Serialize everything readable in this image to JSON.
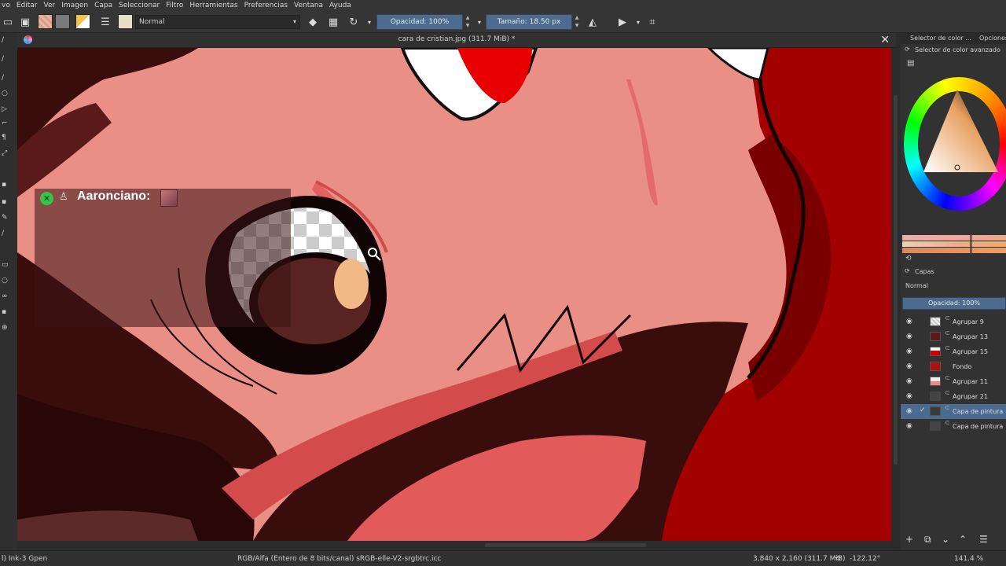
{
  "menu": [
    "vo",
    "Editar",
    "Ver",
    "Imagen",
    "Capa",
    "Seleccionar",
    "Filtro",
    "Herramientas",
    "Preferencias",
    "Ventana",
    "Ayuda"
  ],
  "toolbar": {
    "blend_mode": "Normal",
    "opacity_label": "Opacidad: 100%",
    "size_label": "Tamaño: 18.50 px"
  },
  "document": {
    "tab_title": "cara de cristian.jpg (311.7 MiB) *"
  },
  "overlay": {
    "username": "Aaronciano:"
  },
  "status": {
    "brush": "l) Ink-3 Gpen",
    "color_space": "RGB/Alfa (Entero de 8 bits/canal)  sRGB-elle-V2-srgbtrc.icc",
    "image_size": "3,840 x 2,160 (311.7 MiB)",
    "rotation": "-122.12°",
    "zoom": "141.4 %"
  },
  "docker": {
    "tab_color": "Selector de color ...",
    "tab_options": "Opciones",
    "advanced_color_title": "Selector de color avanzado",
    "layers_title": "Capas",
    "layers_blend": "Normal",
    "layers_opacity": "Opacidad: 100%",
    "layers": [
      {
        "name": "Agrupar 9",
        "checked": false,
        "selected": false
      },
      {
        "name": "Agrupar 13",
        "checked": false,
        "selected": false
      },
      {
        "name": "Agrupar 15",
        "checked": false,
        "selected": false
      },
      {
        "name": "Fondo",
        "checked": false,
        "selected": false
      },
      {
        "name": "Agrupar 11",
        "checked": false,
        "selected": false
      },
      {
        "name": "Agrupar 21",
        "checked": false,
        "selected": false
      },
      {
        "name": "Capa de pintura",
        "checked": true,
        "selected": true
      },
      {
        "name": "Capa de pintura",
        "checked": false,
        "selected": false
      }
    ]
  },
  "colors": {
    "skin": "#e98f85",
    "hair_dark": "#3a0d0d",
    "red": "#a30000",
    "selection": "#4a6a8f"
  }
}
